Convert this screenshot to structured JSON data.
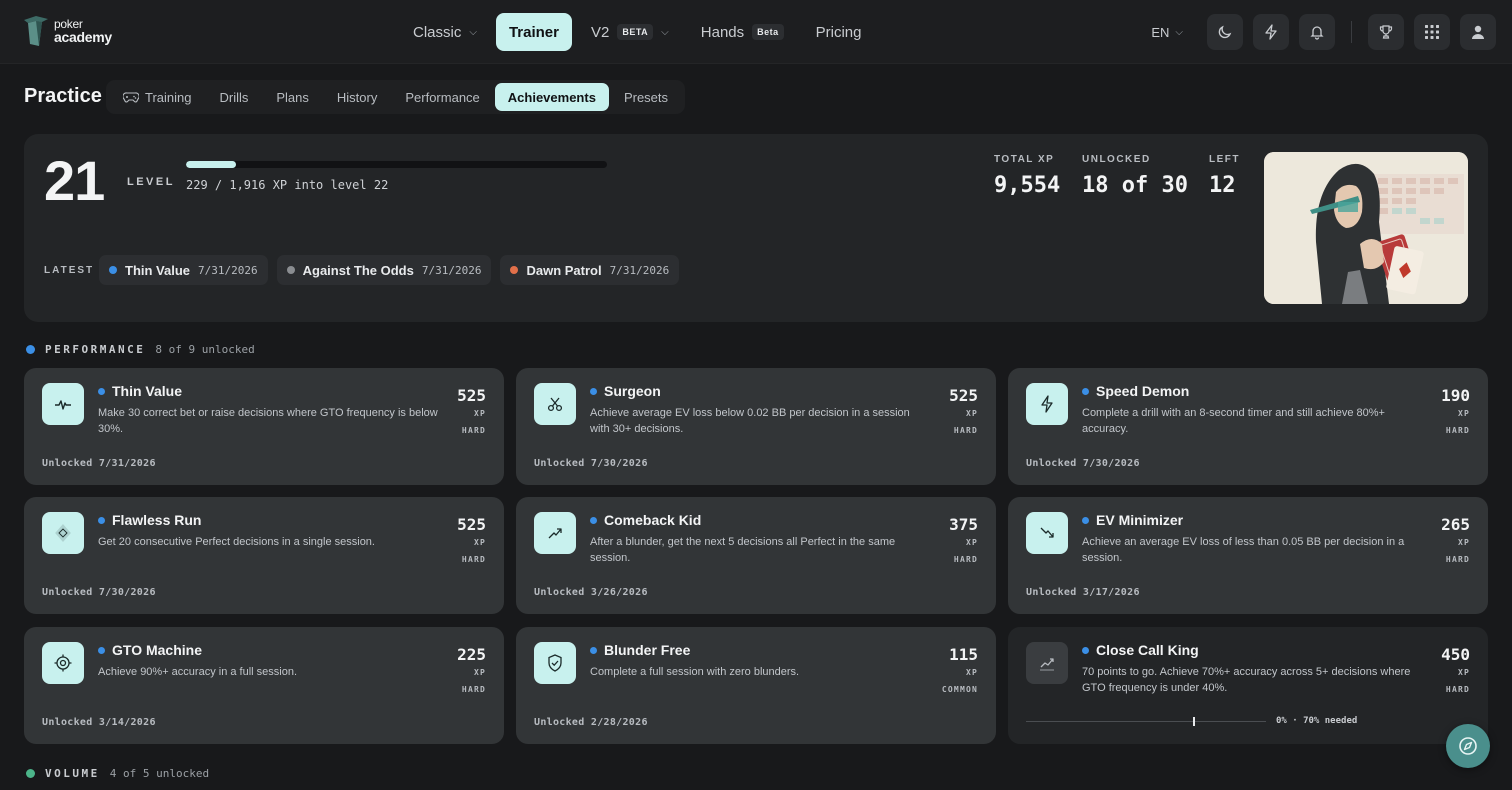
{
  "brand": {
    "line1": "poker",
    "line2": "academy"
  },
  "nav": {
    "items": [
      {
        "label": "Classic",
        "chevron": true
      },
      {
        "label": "Trainer",
        "active": true
      },
      {
        "label": "V2",
        "tag": "BETA",
        "chevron": true
      },
      {
        "label": "Hands",
        "tag": "Beta"
      },
      {
        "label": "Pricing"
      }
    ],
    "language": "EN"
  },
  "practice": {
    "title": "Practice",
    "tabs": [
      "Training",
      "Drills",
      "Plans",
      "History",
      "Performance",
      "Achievements",
      "Presets"
    ],
    "active_tab": "Achievements"
  },
  "level": {
    "number": "21",
    "label": "LEVEL",
    "xp_text": "229 / 1,916 XP into level 22",
    "progress_fraction": 0.1195
  },
  "stats": {
    "total_xp_label": "TOTAL XP",
    "total_xp": "9,554",
    "unlocked_label": "UNLOCKED",
    "unlocked": "18 of 30",
    "left_label": "LEFT",
    "left": "12"
  },
  "latest": {
    "label": "LATEST",
    "items": [
      {
        "name": "Thin Value",
        "date": "7/31/2026",
        "color": "#3b8fe6"
      },
      {
        "name": "Against The Odds",
        "date": "7/31/2026",
        "color": "#8a8d91"
      },
      {
        "name": "Dawn Patrol",
        "date": "7/31/2026",
        "color": "#e2704a"
      }
    ]
  },
  "sections": {
    "performance": {
      "title": "PERFORMANCE",
      "count": "8 of 9 unlocked",
      "color": "#3b8fe6"
    },
    "volume": {
      "title": "VOLUME",
      "count": "4 of 5 unlocked",
      "color": "#4cb58a"
    }
  },
  "achievements": [
    {
      "title": "Thin Value",
      "desc": "Make 30 correct bet or raise decisions where GTO frequency is below 30%.",
      "xp": "525",
      "xp_unit": "XP",
      "difficulty": "HARD",
      "unlocked": "Unlocked 7/31/2026",
      "icon": "pulse-icon"
    },
    {
      "title": "Surgeon",
      "desc": "Achieve average EV loss below 0.02 BB per decision in a session with 30+ decisions.",
      "xp": "525",
      "xp_unit": "XP",
      "difficulty": "HARD",
      "unlocked": "Unlocked 7/30/2026",
      "icon": "scissors-icon"
    },
    {
      "title": "Speed Demon",
      "desc": "Complete a drill with an 8-second timer and still achieve 80%+ accuracy.",
      "xp": "190",
      "xp_unit": "XP",
      "difficulty": "HARD",
      "unlocked": "Unlocked 7/30/2026",
      "icon": "lightning-icon"
    },
    {
      "title": "Flawless Run",
      "desc": "Get 20 consecutive Perfect decisions in a single session.",
      "xp": "525",
      "xp_unit": "XP",
      "difficulty": "HARD",
      "unlocked": "Unlocked 7/30/2026",
      "icon": "gem-icon"
    },
    {
      "title": "Comeback Kid",
      "desc": "After a blunder, get the next 5 decisions all Perfect in the same session.",
      "xp": "375",
      "xp_unit": "XP",
      "difficulty": "HARD",
      "unlocked": "Unlocked 3/26/2026",
      "icon": "trend-up-icon"
    },
    {
      "title": "EV Minimizer",
      "desc": "Achieve an average EV loss of less than 0.05 BB per decision in a session.",
      "xp": "265",
      "xp_unit": "XP",
      "difficulty": "HARD",
      "unlocked": "Unlocked 3/17/2026",
      "icon": "trend-down-icon"
    },
    {
      "title": "GTO Machine",
      "desc": "Achieve 90%+ accuracy in a full session.",
      "xp": "225",
      "xp_unit": "XP",
      "difficulty": "HARD",
      "unlocked": "Unlocked 3/14/2026",
      "icon": "target-icon"
    },
    {
      "title": "Blunder Free",
      "desc": "Complete a full session with zero blunders.",
      "xp": "115",
      "xp_unit": "XP",
      "difficulty": "COMMON",
      "unlocked": "Unlocked 2/28/2026",
      "icon": "shield-check-icon"
    },
    {
      "title": "Close Call King",
      "desc": "70 points to go. Achieve 70%+ accuracy across 5+ decisions where GTO frequency is under 40%.",
      "xp": "450",
      "xp_unit": "XP",
      "difficulty": "HARD",
      "locked": true,
      "progress_text": "0% · 70% needed",
      "progress_target": 0.7,
      "icon": "chart-line-icon"
    }
  ]
}
